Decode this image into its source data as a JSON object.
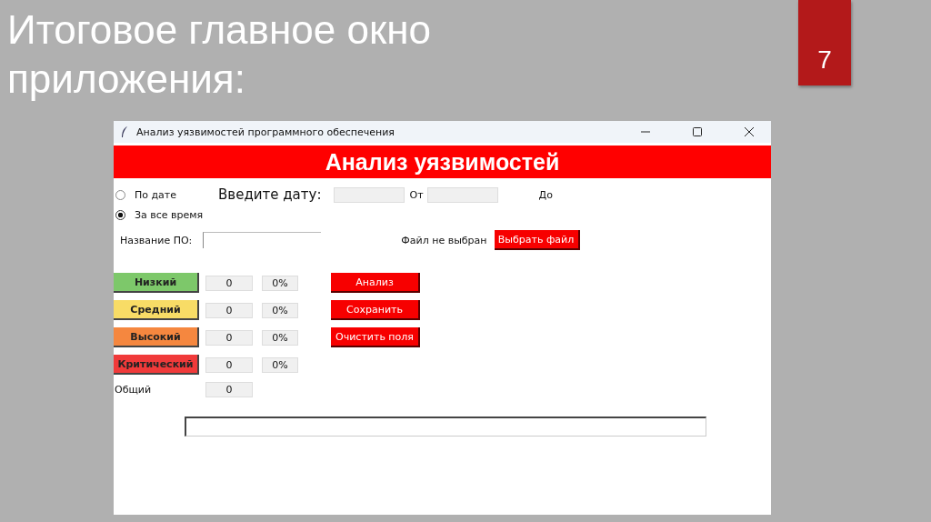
{
  "slide": {
    "title": "Итоговое главное окно приложения:",
    "page_number": "7"
  },
  "window": {
    "title": "Анализ уязвимостей программного обеспечения"
  },
  "header": "Анализ уязвимостей",
  "period_options": [
    {
      "label": "По дате",
      "selected": false
    },
    {
      "label": "За все время",
      "selected": true
    }
  ],
  "date_prompt": "Введите дату:",
  "from_label": "От",
  "to_label": "До",
  "software_label": "Название ПО:",
  "file_status": "Файл не выбран",
  "choose_file_button": "Выбрать файл",
  "levels": [
    {
      "label": "Низкий",
      "color": "#7dc86a",
      "count": "0",
      "percent": "0%"
    },
    {
      "label": "Средний",
      "color": "#f8dc66",
      "count": "0",
      "percent": "0%"
    },
    {
      "label": "Высокий",
      "color": "#f5873f",
      "count": "0",
      "percent": "0%"
    },
    {
      "label": "Критический",
      "color": "#f03a3a",
      "count": "0",
      "percent": "0%"
    }
  ],
  "actions": [
    "Анализ",
    "Сохранить",
    "Очистить поля"
  ],
  "total": {
    "label": "Общий",
    "count": "0"
  }
}
